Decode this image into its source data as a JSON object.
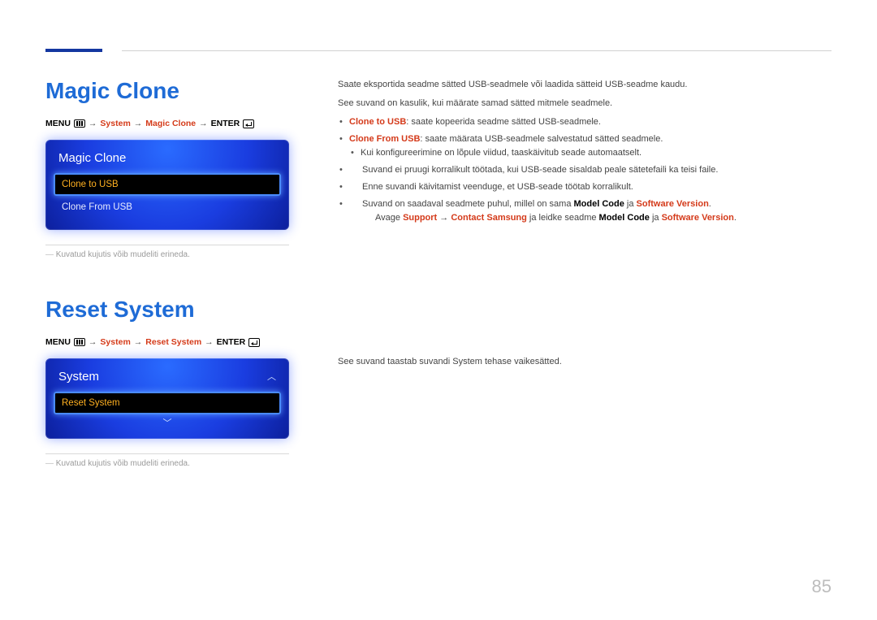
{
  "pageNumber": "85",
  "section1": {
    "title": "Magic Clone",
    "breadcrumb": {
      "menu": "MENU",
      "item1": "System",
      "item2": "Magic Clone",
      "enter": "ENTER"
    },
    "osd": {
      "title": "Magic Clone",
      "selected": "Clone to USB",
      "item2": "Clone From USB"
    },
    "footnote": "Kuvatud kujutis võib mudeliti erineda.",
    "body": {
      "p1": "Saate eksportida seadme sätted USB-seadmele või laadida sätteid USB-seadme kaudu.",
      "p2": "See suvand on kasulik, kui määrate samad sätted mitmele seadmele.",
      "b1_label": "Clone to USB",
      "b1_text": ": saate kopeerida seadme sätted USB-seadmele.",
      "b2_label": "Clone From USB",
      "b2_text": ": saate määrata USB-seadmele salvestatud sätted seadmele.",
      "b2_sub": "Kui konfigureerimine on lõpule viidud, taaskäivitub seade automaatselt.",
      "d1": "Suvand ei pruugi korralikult töötada, kui USB-seade sisaldab peale sätetefaili ka teisi faile.",
      "d2": "Enne suvandi käivitamist veenduge, et USB-seade töötab korralikult.",
      "d3_pre": "Suvand on saadaval seadmete puhul, millel on sama ",
      "d3_mc": "Model Code",
      "d3_mid": " ja ",
      "d3_sv": "Software Version",
      "d3_post": ".",
      "d3b_pre": "Avage ",
      "d3b_sup": "Support",
      "d3b_arr": " → ",
      "d3b_cs": "Contact Samsung",
      "d3b_mid": " ja leidke seadme ",
      "d3b_mc": "Model Code",
      "d3b_mid2": " ja ",
      "d3b_sv": "Software Version",
      "d3b_post": "."
    }
  },
  "section2": {
    "title": "Reset System",
    "breadcrumb": {
      "menu": "MENU",
      "item1": "System",
      "item2": "Reset System",
      "enter": "ENTER"
    },
    "osd": {
      "title": "System",
      "selected": "Reset System"
    },
    "footnote": "Kuvatud kujutis võib mudeliti erineda.",
    "body": {
      "p1": "See suvand taastab suvandi System tehase vaikesätted."
    }
  }
}
